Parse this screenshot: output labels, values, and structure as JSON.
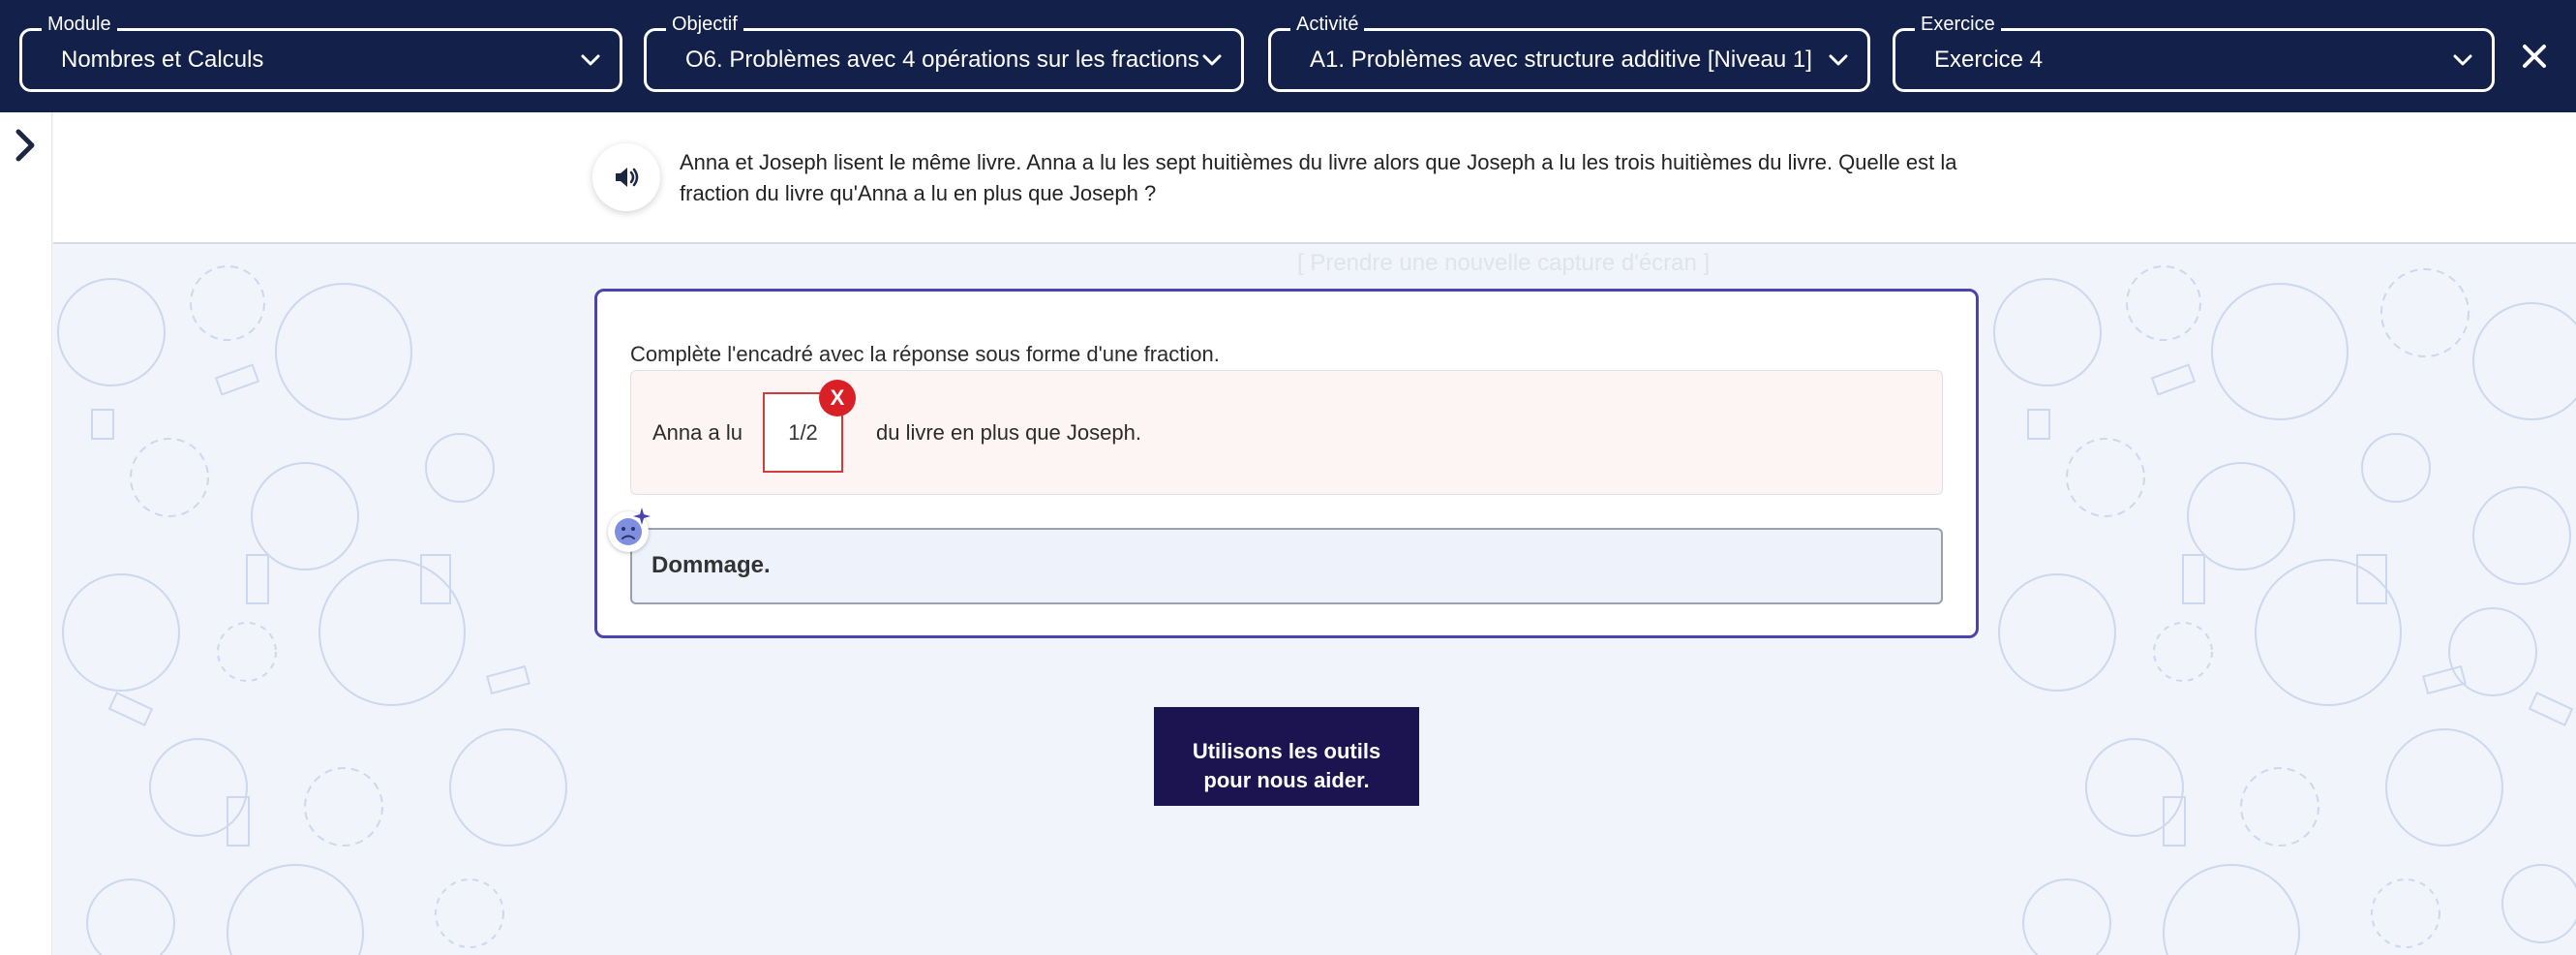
{
  "topbar": {
    "selectors": [
      {
        "legend": "Module",
        "value": "Nombres et Calculs"
      },
      {
        "legend": "Objectif",
        "value": "O6. Problèmes avec 4 opérations sur les fractions"
      },
      {
        "legend": "Activité",
        "value": "A1. Problèmes avec structure additive [Niveau 1]"
      },
      {
        "legend": "Exercice",
        "value": "Exercice 4"
      }
    ],
    "close_icon": "close-icon"
  },
  "question": {
    "text": "Anna et Joseph lisent le même livre. Anna a lu les sept huitièmes du livre alors que Joseph a lu les trois huitièmes du livre. Quelle est la fraction du livre qu'Anna a lu en plus que Joseph ?",
    "audio_icon": "speaker-icon"
  },
  "faint_text": "[ Prendre une nouvelle capture d'écran ]",
  "exercise": {
    "instruction": "Complète l'encadré avec la réponse sous forme d'une fraction.",
    "answer_prefix": "Anna a lu",
    "answer_value": "1/2",
    "answer_suffix": "du livre en plus que Joseph.",
    "error_badge": "X",
    "feedback": "Dommage."
  },
  "help_button": {
    "line1": "Utilisons les outils",
    "line2": "pour nous aider."
  },
  "colors": {
    "topbar": "#13214a",
    "card_border": "#4b44b0",
    "error": "#d92027",
    "help_button": "#1b1450"
  }
}
